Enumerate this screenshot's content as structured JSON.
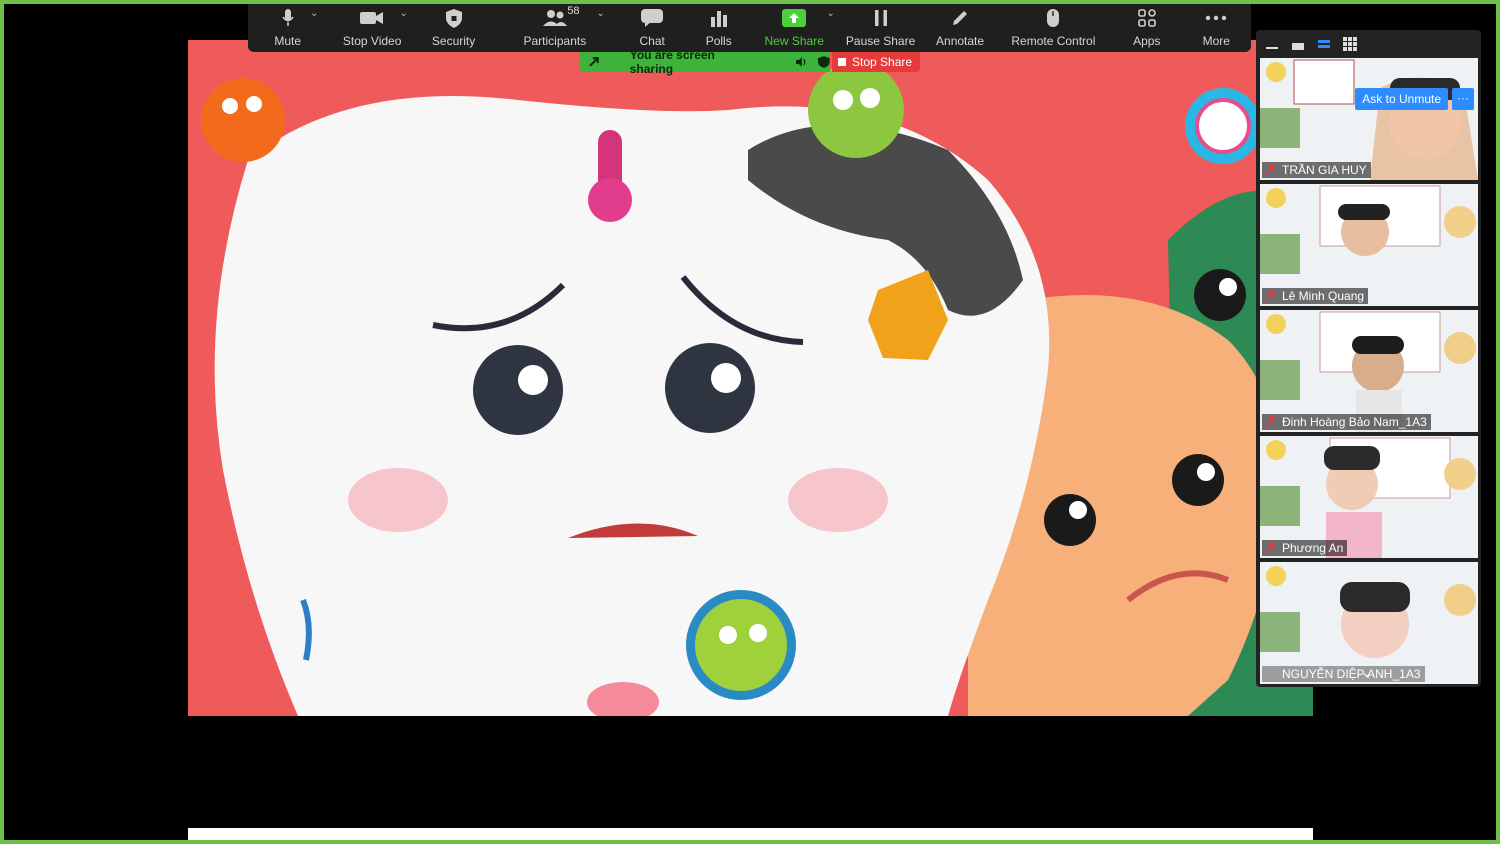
{
  "toolbar": {
    "mute": "Mute",
    "stop_video": "Stop Video",
    "security": "Security",
    "participants": "Participants",
    "participants_count": "58",
    "chat": "Chat",
    "polls": "Polls",
    "new_share": "New Share",
    "pause_share": "Pause Share",
    "annotate": "Annotate",
    "remote_control": "Remote Control",
    "apps": "Apps",
    "more": "More"
  },
  "banner": {
    "sharing_text": "You are screen sharing",
    "stop_share": "Stop Share"
  },
  "gallery": {
    "ask_to_unmute": "Ask to Unmute",
    "more_glyph": "···",
    "participants": [
      {
        "name": "TRẦN GIA HUY"
      },
      {
        "name": "Lê Minh Quang"
      },
      {
        "name": "Đinh Hoàng Bảo Nam_1A3"
      },
      {
        "name": "Phương An"
      },
      {
        "name": "NGUYỄN DIỆP ANH_1A3"
      }
    ]
  },
  "colors": {
    "accent_green": "#4ccf3a",
    "stop_red": "#e53b3b",
    "zoom_blue": "#2d8cff",
    "frame_green": "#6fc04a"
  }
}
